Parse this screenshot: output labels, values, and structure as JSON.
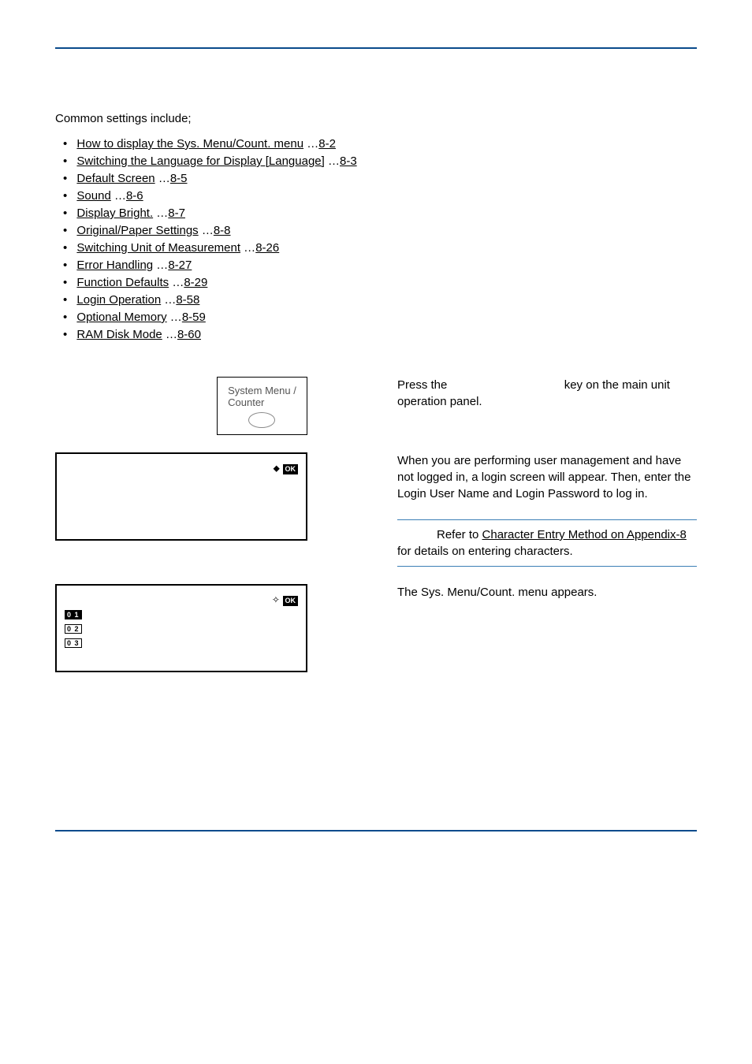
{
  "intro": "Common settings include;",
  "links": [
    {
      "text": "How to display the Sys. Menu/Count. menu",
      "page": "8-2"
    },
    {
      "text": "Switching the Language for Display [Language]",
      "page": "8-3"
    },
    {
      "text": "Default Screen",
      "page": "8-5"
    },
    {
      "text": "Sound",
      "page": "8-6"
    },
    {
      "text": "Display Bright.",
      "page": "8-7"
    },
    {
      "text": "Original/Paper Settings",
      "page": "8-8"
    },
    {
      "text": "Switching Unit of Measurement",
      "page": "8-26"
    },
    {
      "text": "Error Handling",
      "page": "8-27"
    },
    {
      "text": "Function Defaults",
      "page": "8-29"
    },
    {
      "text": "Login Operation",
      "page": "8-58"
    },
    {
      "text": "Optional Memory",
      "page": "8-59"
    },
    {
      "text": "RAM Disk Mode",
      "page": "8-60"
    }
  ],
  "panel": {
    "label_line1": "System Menu /",
    "label_line2": "Counter"
  },
  "step1": {
    "pre": "Press the",
    "post": "key on the main unit operation panel."
  },
  "step2": {
    "text": "When you are performing user management and have not logged in, a login screen will appear. Then, enter the Login User Name and Login Password to log in."
  },
  "note": {
    "pre": "Refer to ",
    "link": "Character Entry Method on Appendix-8",
    "post": " for details on entering characters."
  },
  "step3": {
    "text": "The Sys. Menu/Count. menu appears."
  },
  "lcd2": {
    "row1_left": " ",
    "row1_right": "OK",
    "highlight": "                                           "
  },
  "lcd3": {
    "row1_right": "OK",
    "item1_num": "0 1",
    "item1_text": "                                        ",
    "item2_num": "0 2",
    "item3_num": "0 3"
  }
}
